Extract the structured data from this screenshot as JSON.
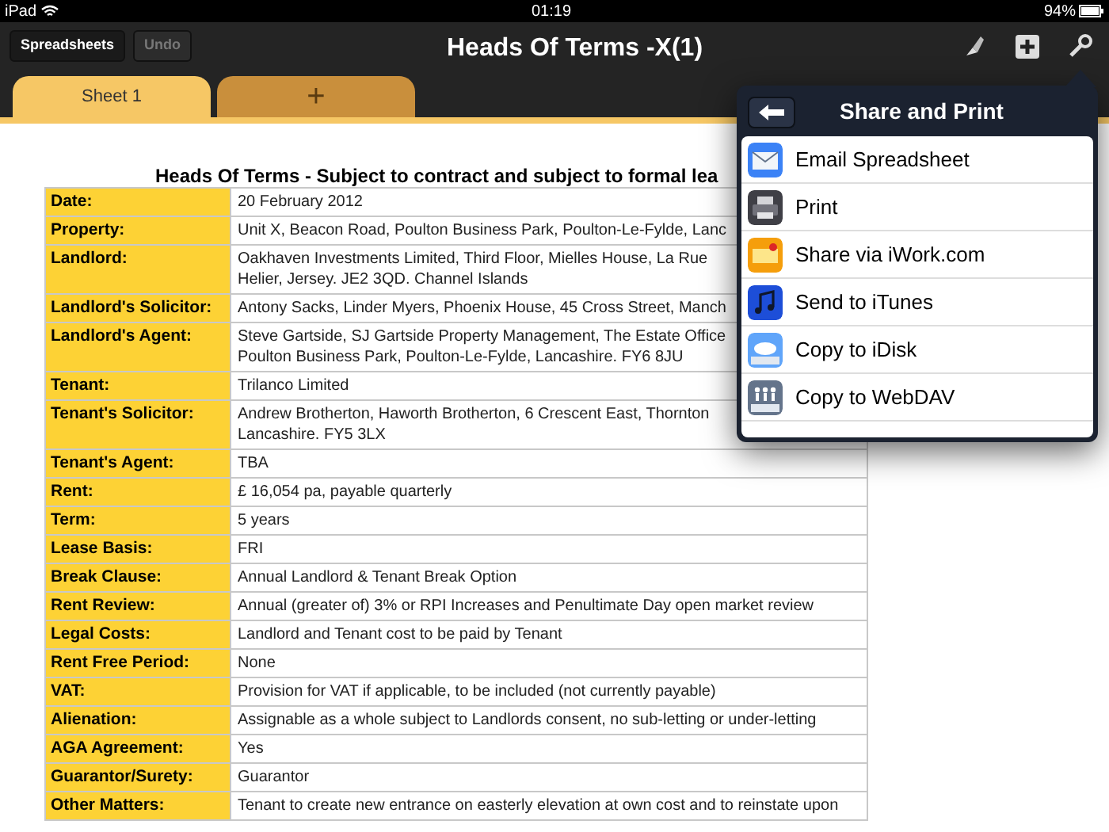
{
  "status_bar": {
    "device": "iPad",
    "time": "01:19",
    "battery": "94%"
  },
  "toolbar": {
    "buttons": [
      {
        "label": "Spreadsheets",
        "disabled": false
      },
      {
        "label": "Undo",
        "disabled": true
      }
    ],
    "title": "Heads Of Terms -X(1)"
  },
  "tabs": [
    {
      "label": "Sheet 1",
      "selected": true
    },
    {
      "label": "+",
      "selected": false
    }
  ],
  "sheet": {
    "title": "Heads Of Terms - Subject to contract and subject to formal lea",
    "rows": [
      {
        "label": "Date:",
        "lines": [
          "20 February 2012"
        ]
      },
      {
        "label": "Property:",
        "lines": [
          "Unit X, Beacon Road, Poulton Business Park, Poulton-Le-Fylde, Lanc"
        ]
      },
      {
        "label": "Landlord:",
        "lines": [
          "Oakhaven Investments Limited, Third Floor,  Mielles House,  La Rue",
          "Helier,  Jersey.  JE2 3QD.  Channel Islands"
        ]
      },
      {
        "label": "Landlord's Solicitor:",
        "lines": [
          "Antony Sacks, Linder Myers, Phoenix House, 45 Cross Street, Manch"
        ]
      },
      {
        "label": "Landlord's Agent:",
        "lines": [
          "Steve Gartside, SJ Gartside Property Management, The Estate Office",
          "Poulton Business Park, Poulton-Le-Fylde, Lancashire. FY6 8JU"
        ]
      },
      {
        "label": "Tenant:",
        "lines": [
          "Trilanco Limited"
        ]
      },
      {
        "label": "Tenant's Solicitor:",
        "lines": [
          "Andrew Brotherton, Haworth Brotherton, 6 Crescent East, Thornton",
          "Lancashire. FY5 3LX"
        ]
      },
      {
        "label": "Tenant's Agent:",
        "lines": [
          "TBA"
        ]
      },
      {
        "label": "Rent:",
        "lines": [
          "£ 16,054 pa, payable quarterly"
        ]
      },
      {
        "label": "Term:",
        "lines": [
          "5 years"
        ]
      },
      {
        "label": "Lease Basis:",
        "lines": [
          "FRI"
        ]
      },
      {
        "label": "Break Clause:",
        "lines": [
          "Annual Landlord & Tenant Break Option"
        ]
      },
      {
        "label": "Rent Review:",
        "lines": [
          "Annual (greater of) 3% or RPI Increases and Penultimate Day open market review"
        ]
      },
      {
        "label": "Legal Costs:",
        "lines": [
          "Landlord and Tenant cost to be paid by Tenant"
        ]
      },
      {
        "label": "Rent Free Period:",
        "lines": [
          "None"
        ]
      },
      {
        "label": "VAT:",
        "lines": [
          "Provision for VAT if applicable, to be included (not currently payable)"
        ]
      },
      {
        "label": "Alienation:",
        "lines": [
          "Assignable as a whole subject to Landlords consent, no sub-letting or under-letting"
        ]
      },
      {
        "label": "AGA Agreement:",
        "lines": [
          "Yes"
        ]
      },
      {
        "label": "Guarantor/Surety:",
        "lines": [
          "Guarantor"
        ]
      },
      {
        "label": "Other Matters:",
        "lines": [
          "Tenant to create new entrance on easterly elevation at own cost and to reinstate upon"
        ]
      }
    ]
  },
  "popover": {
    "title": "Share and Print",
    "items": [
      {
        "label": "Email Spreadsheet",
        "kind": "email"
      },
      {
        "label": "Print",
        "kind": "print"
      },
      {
        "label": "Share via iWork.com",
        "kind": "iwork"
      },
      {
        "label": "Send to iTunes",
        "kind": "itunes"
      },
      {
        "label": "Copy to iDisk",
        "kind": "idisk"
      },
      {
        "label": "Copy to WebDAV",
        "kind": "webdav"
      }
    ]
  }
}
